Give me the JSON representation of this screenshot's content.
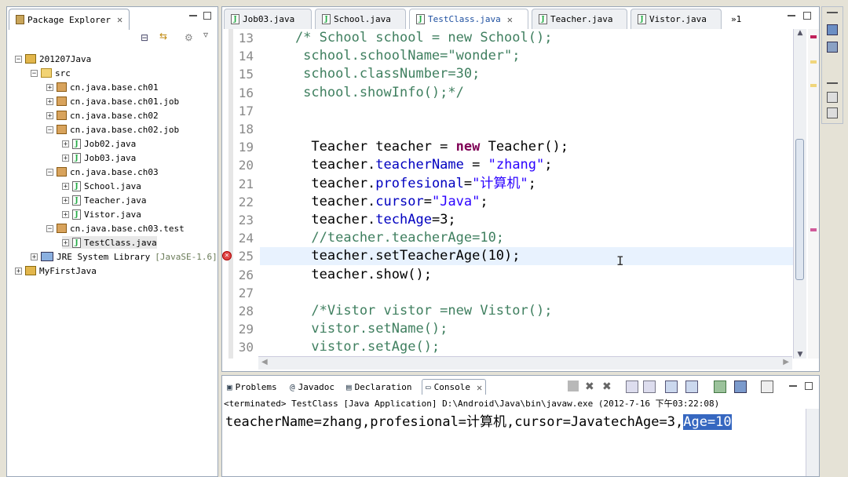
{
  "package_explorer": {
    "title": "Package Explorer",
    "tree": [
      {
        "label": "201207Java",
        "indent": 0,
        "icon": "project-icon",
        "expander": "−"
      },
      {
        "label": "src",
        "indent": 1,
        "icon": "source-folder-icon",
        "expander": "−"
      },
      {
        "label": "cn.java.base.ch01",
        "indent": 2,
        "icon": "package-icon",
        "expander": "+"
      },
      {
        "label": "cn.java.base.ch01.job",
        "indent": 2,
        "icon": "package-icon",
        "expander": "+"
      },
      {
        "label": "cn.java.base.ch02",
        "indent": 2,
        "icon": "package-icon",
        "expander": "+"
      },
      {
        "label": "cn.java.base.ch02.job",
        "indent": 2,
        "icon": "package-icon",
        "expander": "−"
      },
      {
        "label": "Job02.java",
        "indent": 3,
        "icon": "java-file-icon",
        "expander": "+"
      },
      {
        "label": "Job03.java",
        "indent": 3,
        "icon": "java-file-icon",
        "expander": "+"
      },
      {
        "label": "cn.java.base.ch03",
        "indent": 2,
        "icon": "package-icon",
        "expander": "−"
      },
      {
        "label": "School.java",
        "indent": 3,
        "icon": "java-file-icon",
        "expander": "+"
      },
      {
        "label": "Teacher.java",
        "indent": 3,
        "icon": "java-file-icon",
        "expander": "+"
      },
      {
        "label": "Vistor.java",
        "indent": 3,
        "icon": "java-file-icon",
        "expander": "+"
      },
      {
        "label": "cn.java.base.ch03.test",
        "indent": 2,
        "icon": "package-icon",
        "expander": "−"
      },
      {
        "label": "TestClass.java",
        "indent": 3,
        "icon": "java-file-icon",
        "expander": "+",
        "selected": true
      },
      {
        "label": "JRE System Library",
        "suffix": "[JavaSE-1.6]",
        "indent": 1,
        "icon": "library-icon",
        "expander": "+"
      },
      {
        "label": "MyFirstJava",
        "indent": 0,
        "icon": "project-icon",
        "expander": "+"
      }
    ]
  },
  "editor": {
    "tabs": [
      {
        "label": "Job03.java",
        "active": false
      },
      {
        "label": "School.java",
        "active": false
      },
      {
        "label": "TestClass.java",
        "active": true
      },
      {
        "label": "Teacher.java",
        "active": false
      },
      {
        "label": "Vistor.java",
        "active": false
      }
    ],
    "overflow_label": "»1",
    "lines": [
      {
        "n": "13",
        "segs": [
          [
            "cmt",
            "    /* School school = new School();"
          ]
        ]
      },
      {
        "n": "14",
        "segs": [
          [
            "cmt",
            "     school.schoolName=\"wonder\";"
          ]
        ]
      },
      {
        "n": "15",
        "segs": [
          [
            "cmt",
            "     school.classNumber=30;"
          ]
        ]
      },
      {
        "n": "16",
        "segs": [
          [
            "cmt",
            "     school.showInfo();*/"
          ]
        ]
      },
      {
        "n": "17",
        "segs": [
          [
            "",
            ""
          ]
        ]
      },
      {
        "n": "18",
        "segs": [
          [
            "",
            ""
          ]
        ]
      },
      {
        "n": "19",
        "segs": [
          [
            "",
            "      Teacher teacher = "
          ],
          [
            "kw",
            "new"
          ],
          [
            "",
            " Teacher();"
          ]
        ]
      },
      {
        "n": "20",
        "segs": [
          [
            "",
            "      teacher."
          ],
          [
            "fld",
            "teacherName"
          ],
          [
            "",
            " = "
          ],
          [
            "str",
            "\"zhang\""
          ],
          [
            "",
            ";"
          ]
        ]
      },
      {
        "n": "21",
        "segs": [
          [
            "",
            "      teacher."
          ],
          [
            "fld",
            "profesional"
          ],
          [
            "",
            "="
          ],
          [
            "str",
            "\"计算机\""
          ],
          [
            "",
            ";"
          ]
        ]
      },
      {
        "n": "22",
        "segs": [
          [
            "",
            "      teacher."
          ],
          [
            "fld",
            "cursor"
          ],
          [
            "",
            "="
          ],
          [
            "str",
            "\"Java\""
          ],
          [
            "",
            ";"
          ]
        ]
      },
      {
        "n": "23",
        "segs": [
          [
            "",
            "      teacher."
          ],
          [
            "fld",
            "techAge"
          ],
          [
            "",
            "=3;"
          ]
        ]
      },
      {
        "n": "24",
        "segs": [
          [
            "cmt",
            "      //teacher.teacherAge=10;"
          ]
        ]
      },
      {
        "n": "25",
        "segs": [
          [
            "",
            "      teacher.setTeacherAge(10);"
          ]
        ],
        "current": true,
        "error": true
      },
      {
        "n": "26",
        "segs": [
          [
            "",
            "      teacher.show();"
          ]
        ]
      },
      {
        "n": "27",
        "segs": [
          [
            "",
            ""
          ]
        ]
      },
      {
        "n": "28",
        "segs": [
          [
            "cmt",
            "      /*Vistor vistor =new Vistor();"
          ]
        ]
      },
      {
        "n": "29",
        "segs": [
          [
            "cmt",
            "      vistor.setName();"
          ]
        ]
      },
      {
        "n": "30",
        "segs": [
          [
            "cmt",
            "      vistor.setAge();"
          ]
        ]
      }
    ]
  },
  "console": {
    "tabs": [
      "Problems",
      "Javadoc",
      "Declaration",
      "Console"
    ],
    "active_tab": "Console",
    "status": "<terminated> TestClass [Java Application] D:\\Android\\Java\\bin\\javaw.exe (2012-7-16 下午03:22:08)",
    "output_plain": "teacherName=zhang,profesional=计算机,cursor=JavatechAge=3,",
    "output_selected": "Age=10"
  },
  "colors": {
    "comment": "#3f7f5f",
    "field": "#0000c0",
    "string": "#2a00ff",
    "keyword": "#7f0055",
    "selection": "#3667c0"
  }
}
